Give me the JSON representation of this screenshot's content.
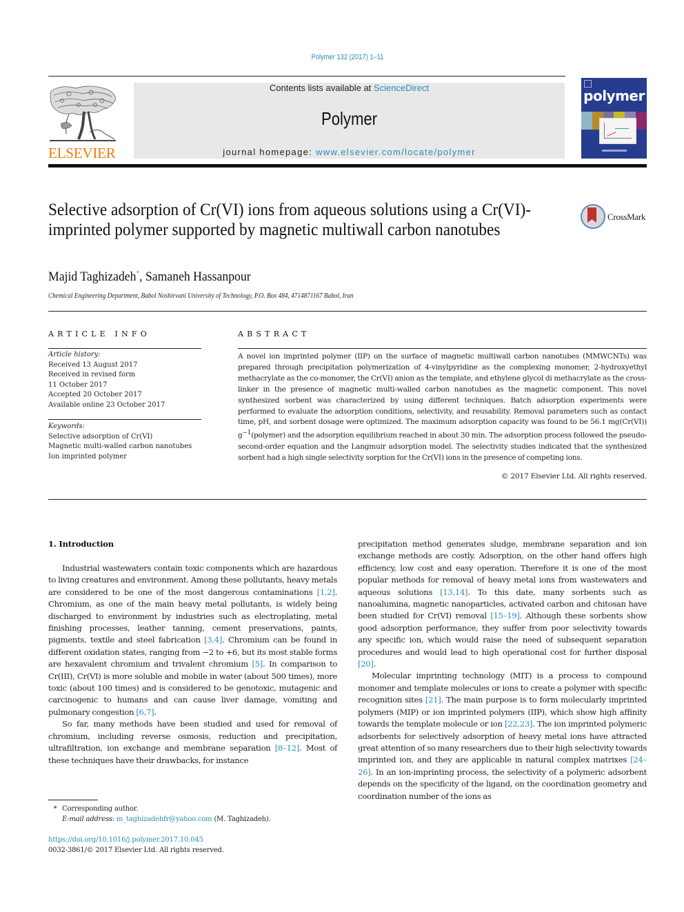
{
  "header": {
    "citation": "Polymer 132 (2017) 1–11",
    "publisher": "ELSEVIER",
    "contents_prefix": "Contents lists available at ",
    "contents_link": "ScienceDirect",
    "journal_name": "Polymer",
    "homepage_prefix": "journal homepage: ",
    "homepage_link": "www.elsevier.com/locate/polymer",
    "cover_title": "polymer",
    "crossmark_label": "CrossMark"
  },
  "article": {
    "title": "Selective adsorption of Cr(VI) ions from aqueous solutions using a Cr(VI)-imprinted polymer supported by magnetic multiwall carbon nanotubes",
    "authors": [
      {
        "name": "Majid Taghizadeh",
        "mark": "*"
      },
      {
        "name": "Samaneh Hassanpour",
        "mark": ""
      }
    ],
    "author_separator": ", ",
    "affiliation": "Chemical Engineering Department, Babol Noshirvani University of Technology, P.O. Box 484, 4714871167 Babol, Iran"
  },
  "article_info": {
    "heading": "ARTICLE INFO",
    "history_label": "Article history:",
    "history": [
      "Received 13 August 2017",
      "Received in revised form",
      "11 October 2017",
      "Accepted 20 October 2017",
      "Available online 23 October 2017"
    ],
    "keywords_label": "Keywords:",
    "keywords": [
      "Selective adsorption of Cr(VI)",
      "Magnetic multi-walled carbon nanotubes",
      "Ion imprinted polymer"
    ]
  },
  "abstract": {
    "heading": "ABSTRACT",
    "text_part1": "A novel ion imprinted polymer (IIP) on the surface of magnetic multiwall carbon nanotubes (MMWCNTs) was prepared through precipitation polymerization of 4-vinylpyridine as the complexing monomer, 2-hydroxyethyl methacrylate as the co-monomer, the Cr(VI) anion as the template, and ethylene glycol di methacrylate as the cross-linker in the presence of magnetic multi-walled carbon nanotubes as the magnetic component. This novel synthesized sorbent was characterized by using different techniques. Batch adsorption experiments were performed to evaluate the adsorption conditions, selectivity, and reusability. Removal parameters such as contact time, pH, and sorbent dosage were optimized. The maximum adsorption capacity was found to be 56.1 mg(Cr(VI)) g",
    "superscript": "−1",
    "text_part2": "(polymer) and the adsorption equilibrium reached in about 30 min. The adsorption process followed the pseudo-second-order equation and the Langmuir adsorption model. The selectivity studies indicated that the synthesized sorbent had a high single selectivity sorption for the Cr(VI) ions in the presence of competing ions.",
    "copyright": "© 2017 Elsevier Ltd. All rights reserved."
  },
  "introduction": {
    "heading": "1.  Introduction",
    "paragraphs": [
      [
        {
          "t": "Industrial wastewaters contain toxic components which are hazardous to living creatures and environment. Among these pollutants, heavy metals are considered to be one of the most dangerous contaminations "
        },
        {
          "ref": "[1,2]"
        },
        {
          "t": ". Chromium, as one of the main heavy metal pollutants, is widely being discharged to environment by industries such as electroplating, metal finishing processes, leather tanning, cement preservations, paints, pigments, textile and steel fabrication "
        },
        {
          "ref": "[3,4]"
        },
        {
          "t": ". Chromium can be found in different oxidation states, ranging from −2 to +6, but its most stable forms are hexavalent chromium and trivalent chromium "
        },
        {
          "ref": "[5]"
        },
        {
          "t": ". In comparison to Cr(III), Cr(VI) is more soluble and mobile in water (about 500 times), more toxic (about 100 times) and is considered to be genotoxic, mutagenic and carcinogenic to humans and can cause liver damage, vomiting and pulmonary congestion "
        },
        {
          "ref": "[6,7]"
        },
        {
          "t": "."
        }
      ],
      [
        {
          "t": "So far, many methods have been studied and used for removal of chromium, including reverse osmosis, reduction and precipitation, ultrafiltration, ion exchange and membrane separation "
        },
        {
          "ref": "[8–12]"
        },
        {
          "t": ". Most of these techniques have their drawbacks, for instance precipitation method generates sludge, membrane separation and ion exchange methods are costly. Adsorption, on the other hand offers high efficiency, low cost and easy operation. Therefore it is one of the most popular methods for removal of heavy metal ions from wastewaters and aqueous solutions "
        },
        {
          "ref": "[13,14]"
        },
        {
          "t": ". To this date, many sorbents such as nanoalumina, magnetic nanoparticles, activated carbon and chitosan have been studied for Cr(VI) removal "
        },
        {
          "ref": "[15–19]"
        },
        {
          "t": ". Although these sorbents show good adsorption performance, they suffer from poor selectivity towards any specific ion, which would raise the need of subsequent separation procedures and would lead to high operational cost for further disposal "
        },
        {
          "ref": "[20]"
        },
        {
          "t": "."
        }
      ],
      [
        {
          "t": "Molecular imprinting technology (MIT) is a process to compound monomer and template molecules or ions to create a polymer with specific recognition sites "
        },
        {
          "ref": "[21]"
        },
        {
          "t": ". The main purpose is to form molecularly imprinted polymers (MIP) or ion imprinted polymers (IIP), which show high affinity towards the template molecule or ion "
        },
        {
          "ref": "[22,23]"
        },
        {
          "t": ". The ion imprinted polymeric adsorbents for selectively adsorption of heavy metal ions have attracted great attention of so many researchers due to their high selectivity towards imprinted ion, and they are applicable in natural complex matrixes "
        },
        {
          "ref": "[24–26]"
        },
        {
          "t": ". In an ion-imprinting process, the selectivity of a polymeric adsorbent depends on the specificity of the ligand, on the coordination geometry and coordination number of the ions as"
        }
      ]
    ]
  },
  "footnotes": {
    "star": "*",
    "corresponding": "Corresponding author.",
    "email_label": "E-mail address: ",
    "email": "m_taghizadehfr@yahoo.com",
    "email_owner": " (M. Taghizadeh).",
    "doi": "https://doi.org/10.1016/j.polymer.2017.10.045",
    "issn_copyright": "0032-3861/© 2017 Elsevier Ltd. All rights reserved."
  },
  "colors": {
    "link": "#2a8cb4",
    "elsevier_orange": "#f07d00",
    "cover_blue": "#263c8f",
    "banner_gray": "#e8e8e8",
    "crossmark_red": "#c0322b"
  }
}
